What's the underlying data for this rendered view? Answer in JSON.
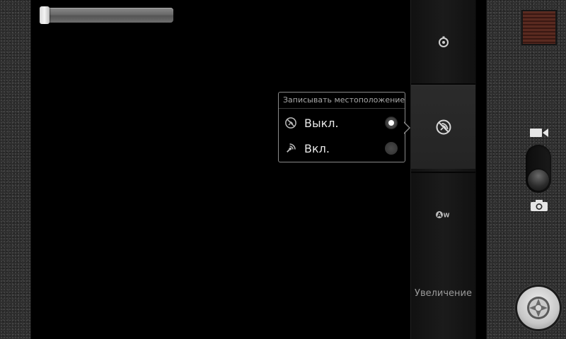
{
  "zoom": {
    "level": 0.0
  },
  "settings": {
    "timer_icon": "self-timer-icon",
    "location_icon": "gps-tag-off-icon",
    "white_balance_icon": "white-balance-auto-icon",
    "zoom_label": "Увеличение"
  },
  "location_popup": {
    "title": "Записывать местоположение",
    "options": [
      {
        "label": "Выкл.",
        "icon": "gps-off-icon",
        "selected": true
      },
      {
        "label": "Вкл.",
        "icon": "gps-on-icon",
        "selected": false
      }
    ]
  },
  "controls": {
    "thumbnail": "last-photo-thumbnail",
    "video_mode_icon": "video-camera-icon",
    "photo_mode_icon": "camera-icon",
    "shutter_icon": "shutter-icon",
    "active_mode": "photo"
  }
}
